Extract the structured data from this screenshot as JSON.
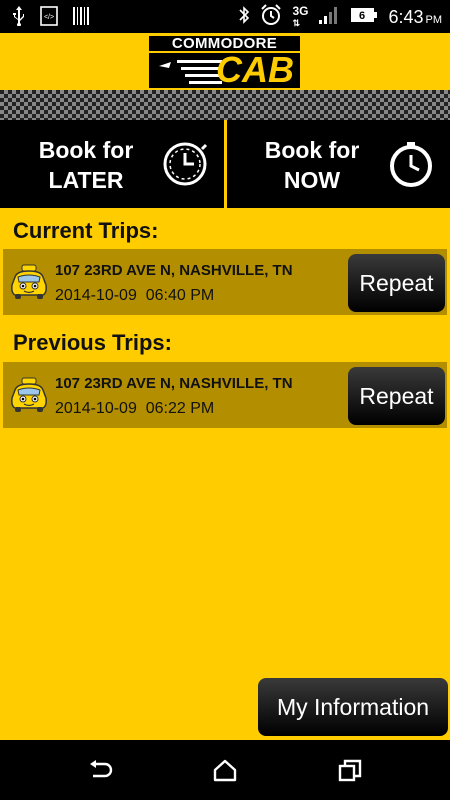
{
  "status_bar": {
    "time": "6:43",
    "ampm": "PM",
    "network": "3G",
    "icons": [
      "usb-icon",
      "code-icon",
      "barcode-icon",
      "bluetooth-icon",
      "alarm-icon",
      "signal-icon",
      "battery-icon"
    ]
  },
  "header": {
    "logo_top": "COMMODORE",
    "logo_bottom": "CAB"
  },
  "booking": {
    "later_line1": "Book for",
    "later_line2": "LATER",
    "now_line1": "Book for",
    "now_line2": "NOW"
  },
  "current_trips": {
    "title": "Current Trips:",
    "items": [
      {
        "address": "107 23RD AVE N, NASHVILLE, TN",
        "datetime": "2014-10-09  06:40 PM",
        "action": "Repeat"
      }
    ]
  },
  "previous_trips": {
    "title": "Previous Trips:",
    "items": [
      {
        "address": "107 23RD AVE N, NASHVILLE, TN",
        "datetime": "2014-10-09  06:22 PM",
        "action": "Repeat"
      }
    ]
  },
  "footer": {
    "my_information": "My Information"
  },
  "colors": {
    "brand_yellow": "#ffcc00",
    "row_dark_yellow": "#b38f00",
    "button_black": "#000000"
  }
}
